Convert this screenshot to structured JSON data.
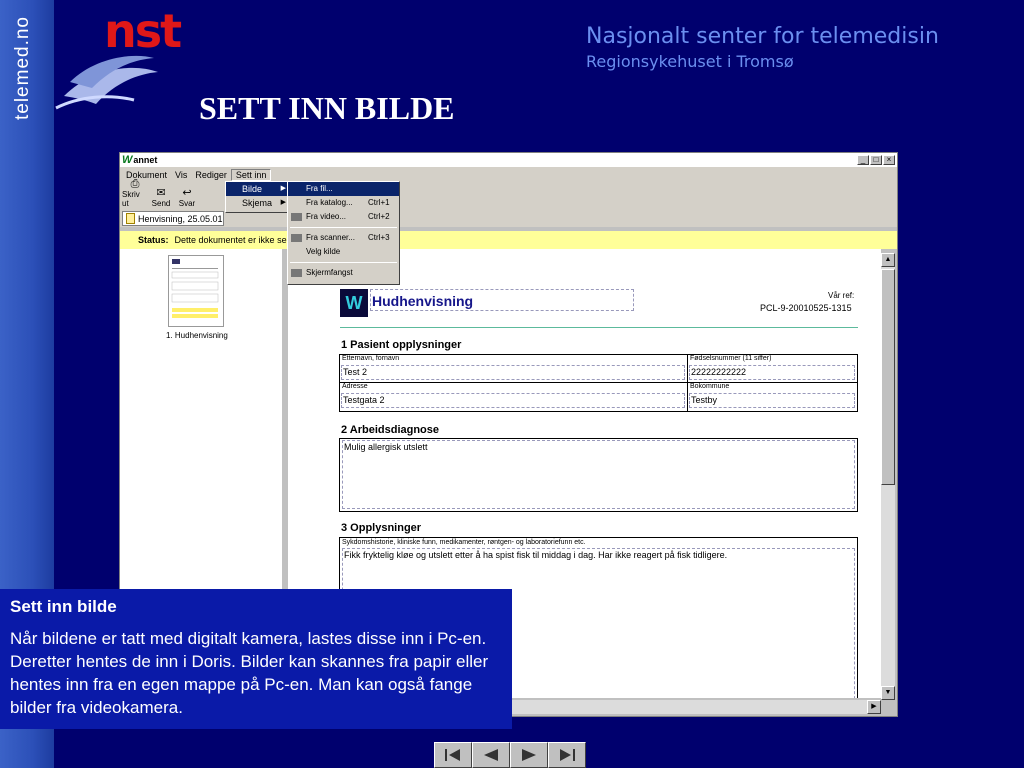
{
  "side_text": "telemed.no",
  "logo": {
    "text": "nst"
  },
  "org": {
    "name": "Nasjonalt senter for telemedisin",
    "sub": "Regionsykehuset i Tromsø"
  },
  "slide_title": "SETT INN BILDE",
  "app": {
    "title": "annet",
    "menu": [
      "Dokument",
      "Vis",
      "Rediger",
      "Sett inn"
    ],
    "toolbar": [
      {
        "label": "Skriv ut",
        "icon": "printer-icon"
      },
      {
        "label": "Send",
        "icon": "send-icon"
      },
      {
        "label": "Svar",
        "icon": "reply-icon"
      }
    ],
    "doc_tab": "Henvisning, 25.05.01",
    "status_label": "Status:",
    "status_text": "Dette dokumentet er ikke send",
    "thumb_caption": "1. Hudhenvisning",
    "submenu": [
      {
        "label": "Bilde",
        "highlight": true
      },
      {
        "label": "Skjema",
        "highlight": false
      }
    ],
    "flyout": [
      {
        "label": "Fra fil...",
        "shortcut": "",
        "highlight": true
      },
      {
        "label": "Fra katalog...",
        "shortcut": "Ctrl+1"
      },
      {
        "label": "Fra video...",
        "shortcut": "Ctrl+2"
      },
      {
        "label": "Fra scanner...",
        "shortcut": "Ctrl+3"
      },
      {
        "label": "Velg kilde",
        "shortcut": ""
      },
      {
        "label": "Skjermfangst",
        "shortcut": ""
      }
    ]
  },
  "document": {
    "title": "Hudhenvisning",
    "ref_label": "Vår ref:",
    "ref_value": "PCL-9-20010525-1315",
    "sec1_title": "1 Pasient opplysninger",
    "name_label": "Etternavn, fornavn",
    "name_value": "Test 2",
    "ssn_label": "Fødselsnummer (11 siffer)",
    "ssn_value": "22222222222",
    "address_label": "Adresse",
    "address_value": "Testgata 2",
    "municipality_label": "Bokommune",
    "municipality_value": "Testby",
    "sec2_title": "2 Arbeidsdiagnose",
    "diagnosis": "Mulig allergisk utslett",
    "sec3_title": "3 Opplysninger",
    "info_label": "Sykdomshistorie, kliniske funn, medikamenter, røntgen- og laboratoriefunn etc.",
    "info_text": "Fikk fryktelig kløe og utslett etter å ha spist fisk til middag i dag. Har ikke reagert på fisk tidligere."
  },
  "caption": {
    "title": "Sett inn bilde",
    "body": "Når bildene er tatt med digitalt kamera, lastes disse inn i Pc-en. Deretter hentes de inn i Doris. Bilder kan skannes fra papir eller hentes inn fra en egen mappe på Pc-en. Man kan også fange bilder fra videokamera."
  }
}
